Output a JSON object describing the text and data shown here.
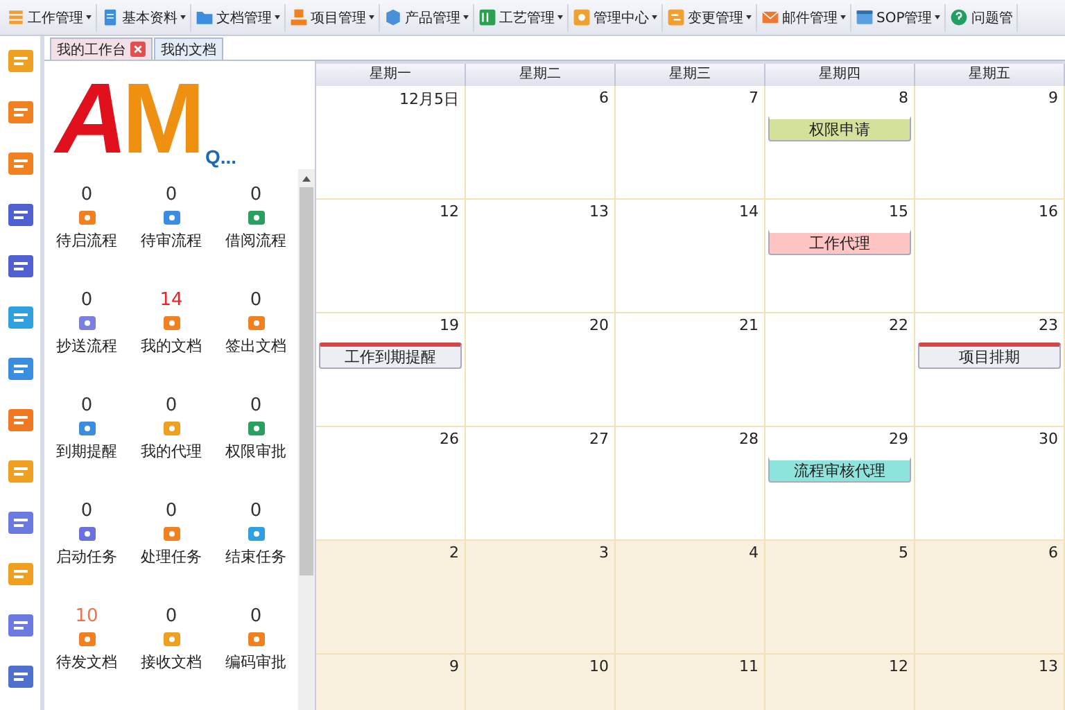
{
  "menu": [
    {
      "label": "工作管理"
    },
    {
      "label": "基本资料"
    },
    {
      "label": "文档管理"
    },
    {
      "label": "项目管理"
    },
    {
      "label": "产品管理"
    },
    {
      "label": "工艺管理"
    },
    {
      "label": "管理中心"
    },
    {
      "label": "变更管理"
    },
    {
      "label": "邮件管理"
    },
    {
      "label": "SOP管理"
    },
    {
      "label": "问题管"
    }
  ],
  "tabs": [
    {
      "label": "我的工作台",
      "selected": true,
      "closable": true
    },
    {
      "label": "我的文档",
      "selected": false,
      "closable": false
    }
  ],
  "logo": {
    "part_1": "A",
    "part_2": "M",
    "part_3": "Q..."
  },
  "tiles": [
    {
      "count": "0",
      "label": "待启流程",
      "color": "#333333"
    },
    {
      "count": "0",
      "label": "待审流程",
      "color": "#333333"
    },
    {
      "count": "0",
      "label": "借阅流程",
      "color": "#333333"
    },
    {
      "count": "0",
      "label": "抄送流程",
      "color": "#333333"
    },
    {
      "count": "14",
      "label": "我的文档",
      "color": "#ee2222"
    },
    {
      "count": "0",
      "label": "签出文档",
      "color": "#333333"
    },
    {
      "count": "0",
      "label": "到期提醒",
      "color": "#333333"
    },
    {
      "count": "0",
      "label": "我的代理",
      "color": "#333333"
    },
    {
      "count": "0",
      "label": "权限审批",
      "color": "#333333"
    },
    {
      "count": "0",
      "label": "启动任务",
      "color": "#333333"
    },
    {
      "count": "0",
      "label": "处理任务",
      "color": "#333333"
    },
    {
      "count": "0",
      "label": "结束任务",
      "color": "#333333"
    },
    {
      "count": "10",
      "label": "待发文档",
      "color": "#f07050"
    },
    {
      "count": "0",
      "label": "接收文档",
      "color": "#333333"
    },
    {
      "count": "0",
      "label": "编码审批",
      "color": "#333333"
    }
  ],
  "calendar": {
    "columns": [
      "星期一",
      "星期二",
      "星期三",
      "星期四",
      "星期五"
    ],
    "weeks": [
      [
        {
          "day": "12月5日",
          "other_month": false
        },
        {
          "day": "6",
          "other_month": false
        },
        {
          "day": "7",
          "other_month": false
        },
        {
          "day": "8",
          "other_month": false,
          "events": [
            {
              "label": "权限申请",
              "kind": "plain",
              "color": "#d4e19a"
            }
          ]
        },
        {
          "day": "9",
          "other_month": false
        }
      ],
      [
        {
          "day": "12",
          "other_month": false
        },
        {
          "day": "13",
          "other_month": false
        },
        {
          "day": "14",
          "other_month": false
        },
        {
          "day": "15",
          "other_month": false,
          "events": [
            {
              "label": "工作代理",
              "kind": "plain",
              "color": "#ffc4c4"
            }
          ]
        },
        {
          "day": "16",
          "other_month": false
        }
      ],
      [
        {
          "day": "19",
          "other_month": false,
          "events": [
            {
              "label": "工作到期提醒",
              "kind": "flagged",
              "color": "#eceef4"
            }
          ]
        },
        {
          "day": "20",
          "other_month": false
        },
        {
          "day": "21",
          "other_month": false
        },
        {
          "day": "22",
          "other_month": false
        },
        {
          "day": "23",
          "other_month": false,
          "events": [
            {
              "label": "项目排期",
              "kind": "flagged",
              "color": "#eceef4"
            }
          ]
        }
      ],
      [
        {
          "day": "26",
          "other_month": false
        },
        {
          "day": "27",
          "other_month": false
        },
        {
          "day": "28",
          "other_month": false
        },
        {
          "day": "29",
          "other_month": false,
          "events": [
            {
              "label": "流程审核代理",
              "kind": "plain",
              "color": "#8ee4dc"
            }
          ]
        },
        {
          "day": "30",
          "other_month": false
        }
      ],
      [
        {
          "day": "2",
          "other_month": true
        },
        {
          "day": "3",
          "other_month": true
        },
        {
          "day": "4",
          "other_month": true
        },
        {
          "day": "5",
          "other_month": true
        },
        {
          "day": "6",
          "other_month": true
        }
      ],
      [
        {
          "day": "9",
          "other_month": true
        },
        {
          "day": "10",
          "other_month": true
        },
        {
          "day": "11",
          "other_month": true
        },
        {
          "day": "12",
          "other_month": true
        },
        {
          "day": "13",
          "other_month": true
        }
      ]
    ]
  }
}
